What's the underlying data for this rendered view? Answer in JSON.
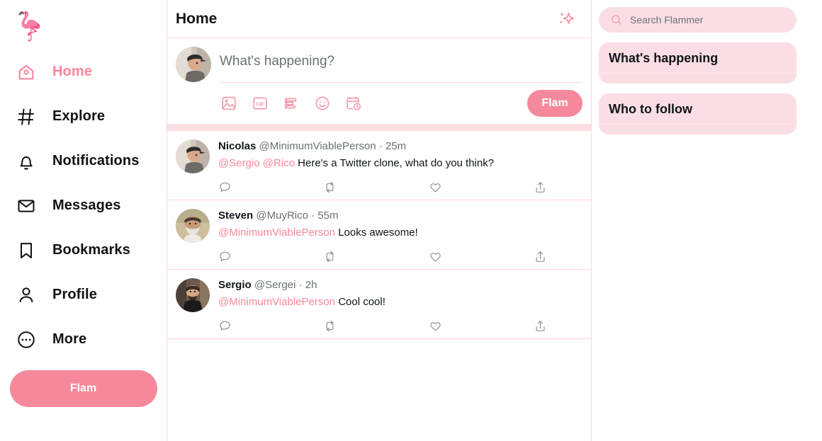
{
  "theme": {
    "accent": "#f5899b",
    "accent_light": "#f8879b",
    "border": "#fbd7de",
    "surface_pink": "#fbdee4",
    "text": "#0f1419",
    "muted": "#6b7177",
    "icon_muted": "#8d9196"
  },
  "sidebar": {
    "logo_icon": "flamingo-icon",
    "logo_glyph": "🦩",
    "items": [
      {
        "label": "Home",
        "icon": "home-icon",
        "active": true
      },
      {
        "label": "Explore",
        "icon": "hash-icon",
        "active": false
      },
      {
        "label": "Notifications",
        "icon": "bell-icon",
        "active": false
      },
      {
        "label": "Messages",
        "icon": "envelope-icon",
        "active": false
      },
      {
        "label": "Bookmarks",
        "icon": "bookmark-icon",
        "active": false
      },
      {
        "label": "Profile",
        "icon": "person-icon",
        "active": false
      },
      {
        "label": "More",
        "icon": "ellipsis-circle-icon",
        "active": false
      }
    ],
    "flam_button_label": "Flam"
  },
  "center": {
    "title": "Home",
    "sparkle_icon": "sparkles-icon",
    "composer": {
      "placeholder": "What's happening?",
      "value": "",
      "avatar_icon": "avatar-nicolas",
      "tools": [
        {
          "icon": "image-icon",
          "label": "Media"
        },
        {
          "icon": "gif-icon",
          "label": "GIF"
        },
        {
          "icon": "poll-icon",
          "label": "Poll"
        },
        {
          "icon": "emoji-icon",
          "label": "Emoji"
        },
        {
          "icon": "schedule-icon",
          "label": "Schedule"
        }
      ],
      "submit_label": "Flam"
    },
    "tweets": [
      {
        "avatar_icon": "avatar-nicolas",
        "name": "Nicolas",
        "handle": "@MinimumViablePerson",
        "separator": "·",
        "time": "25m",
        "mentions": [
          "@Sergio",
          "@Rico"
        ],
        "text": "Here's a Twitter clone, what do you think?",
        "actions": [
          {
            "icon": "reply-icon",
            "count": ""
          },
          {
            "icon": "retweet-icon",
            "count": ""
          },
          {
            "icon": "like-icon",
            "count": ""
          },
          {
            "icon": "share-icon",
            "count": ""
          }
        ]
      },
      {
        "avatar_icon": "avatar-steven",
        "name": "Steven",
        "handle": "@MuyRico",
        "separator": "·",
        "time": "55m",
        "mentions": [
          "@MinimumViablePerson"
        ],
        "text": "Looks awesome!",
        "actions": [
          {
            "icon": "reply-icon",
            "count": ""
          },
          {
            "icon": "retweet-icon",
            "count": ""
          },
          {
            "icon": "like-icon",
            "count": ""
          },
          {
            "icon": "share-icon",
            "count": ""
          }
        ]
      },
      {
        "avatar_icon": "avatar-sergio",
        "name": "Sergio",
        "handle": "@Sergei",
        "separator": "·",
        "time": "2h",
        "mentions": [
          "@MinimumViablePerson"
        ],
        "text": "Cool cool!",
        "actions": [
          {
            "icon": "reply-icon",
            "count": ""
          },
          {
            "icon": "retweet-icon",
            "count": ""
          },
          {
            "icon": "like-icon",
            "count": ""
          },
          {
            "icon": "share-icon",
            "count": ""
          }
        ]
      }
    ]
  },
  "right": {
    "search": {
      "icon": "search-icon",
      "placeholder": "Search Flammer",
      "value": ""
    },
    "widgets": [
      {
        "title": "What's happening"
      },
      {
        "title": "Who to follow"
      }
    ]
  }
}
